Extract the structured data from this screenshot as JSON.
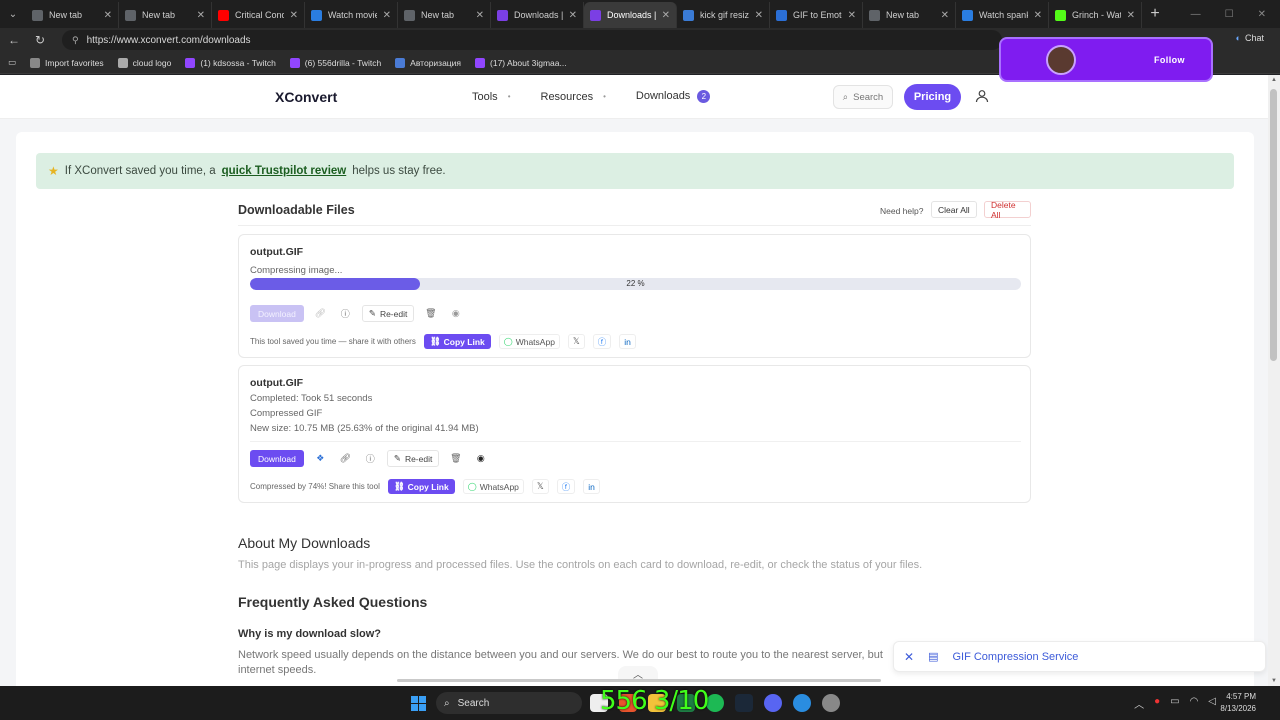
{
  "browser": {
    "tabs": [
      {
        "title": "New tab",
        "color": "#5f6368",
        "active": false
      },
      {
        "title": "New tab",
        "color": "#5f6368",
        "active": false
      },
      {
        "title": "Critical Conditi",
        "color": "#ff0000",
        "active": false
      },
      {
        "title": "Watch movie m",
        "color": "#2a7de1",
        "active": false
      },
      {
        "title": "New tab",
        "color": "#5f6368",
        "active": false
      },
      {
        "title": "Downloads | XC",
        "color": "#7b3fe4",
        "active": false
      },
      {
        "title": "Downloads | X",
        "color": "#7b3fe4",
        "active": true
      },
      {
        "title": "kick gif resizer",
        "color": "#3a7bd5",
        "active": false
      },
      {
        "title": "GIF to Emote C",
        "color": "#2b6fd6",
        "active": false
      },
      {
        "title": "New tab",
        "color": "#5f6368",
        "active": false
      },
      {
        "title": "Watch spanky",
        "color": "#2a7de1",
        "active": false
      },
      {
        "title": "Grinch - Watch",
        "color": "#53fc18",
        "active": false
      }
    ],
    "url": "https://www.xconvert.com/downloads",
    "chat_label": "Chat",
    "bookmarks": [
      {
        "label": "Import favorites",
        "color": "#888888"
      },
      {
        "label": "cloud logo",
        "color": "#aaaaaa"
      },
      {
        "label": "(1) kdsossa - Twitch",
        "color": "#9146ff"
      },
      {
        "label": "(6) 556drilla - Twitch",
        "color": "#9146ff"
      },
      {
        "label": "Авторизация",
        "color": "#4a7bd5"
      },
      {
        "label": "(17) About 3igmaa...",
        "color": "#9146ff"
      }
    ]
  },
  "twitch_overlay": {
    "follow_label": "Follow"
  },
  "site": {
    "logo": "XConvert",
    "nav": {
      "tools": "Tools",
      "resources": "Resources",
      "downloads": "Downloads",
      "downloads_count": "2"
    },
    "search_label": "Search",
    "pricing_label": "Pricing"
  },
  "promo": {
    "prefix": "If XConvert saved you time, a",
    "link": "quick Trustpilot review",
    "suffix": "helps us stay free."
  },
  "files_section": {
    "title": "Downloadable Files",
    "need_help": "Need help?",
    "clear_all": "Clear All",
    "delete_all": "Delete All"
  },
  "file1": {
    "name": "output.GIF",
    "status": "Compressing image...",
    "progress": 22,
    "progress_label": "22 %",
    "download_label": "Download",
    "reedit_label": "Re-edit",
    "share_text": "This tool saved you time — share it with others",
    "copy_link": "Copy Link",
    "whatsapp": "WhatsApp"
  },
  "file2": {
    "name": "output.GIF",
    "line1": "Completed: Took 51 seconds",
    "line2": "Compressed GIF",
    "line3": "New size: 10.75 MB (25.63% of the original 41.94 MB)",
    "download_label": "Download",
    "reedit_label": "Re-edit",
    "share_text": "Compressed by 74%! Share this tool",
    "copy_link": "Copy Link",
    "whatsapp": "WhatsApp"
  },
  "about": {
    "title": "About My Downloads",
    "text": "This page displays your in-progress and processed files. Use the controls on each card to download, re-edit, or check the status of your files."
  },
  "faq": {
    "title": "Frequently Asked Questions",
    "q1": "Why is my download slow?",
    "a1": "Network speed usually depends on the distance between you and our servers. We do our best to route you to the nearest server, but internet speeds."
  },
  "toast": {
    "label": "GIF Compression Service"
  },
  "taskbar": {
    "search_label": "Search",
    "counter": "556 3/10",
    "time": "4:57 PM",
    "date": "8/13/2026"
  }
}
